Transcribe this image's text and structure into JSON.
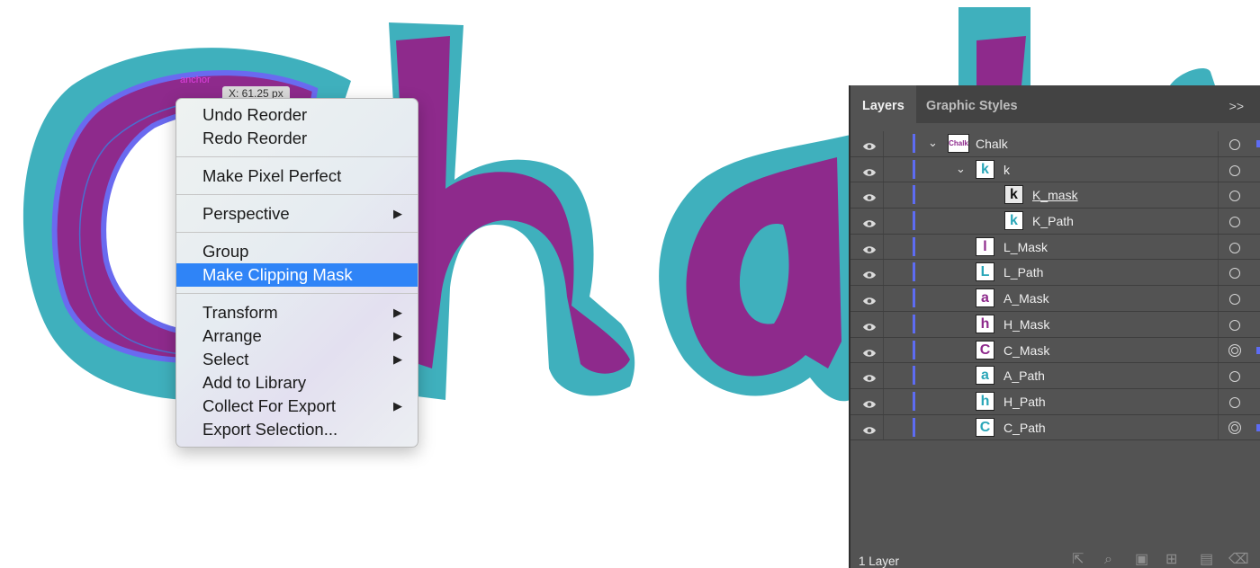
{
  "tooltip": {
    "text": "X: 61.25 px"
  },
  "canvas": {
    "anchor_label": "anchor"
  },
  "context_menu": {
    "items": [
      {
        "label": "Undo Reorder"
      },
      {
        "label": "Redo Reorder"
      },
      {
        "label": "Make Pixel Perfect"
      },
      {
        "label": "Perspective",
        "submenu": true
      },
      {
        "label": "Group"
      },
      {
        "label": "Make Clipping Mask",
        "selected": true
      },
      {
        "label": "Transform",
        "submenu": true
      },
      {
        "label": "Arrange",
        "submenu": true
      },
      {
        "label": "Select",
        "submenu": true
      },
      {
        "label": "Add to Library"
      },
      {
        "label": "Collect For Export",
        "submenu": true
      },
      {
        "label": "Export Selection..."
      }
    ]
  },
  "layers_panel": {
    "tabs": [
      {
        "label": "Layers",
        "active": true
      },
      {
        "label": "Graphic Styles",
        "active": false
      }
    ],
    "menu_icon": ">>",
    "layers": [
      {
        "name": "Chalk",
        "thumb": "Chalk",
        "indent": 0,
        "expanded": true
      },
      {
        "name": "k",
        "thumb": "k",
        "indent": 1,
        "expanded": true
      },
      {
        "name": "K_mask",
        "thumb": "k",
        "indent": 2
      },
      {
        "name": "K_Path",
        "thumb": "k",
        "indent": 2
      },
      {
        "name": "L_Mask",
        "thumb": "l",
        "indent": 1
      },
      {
        "name": "L_Path",
        "thumb": "L",
        "indent": 1
      },
      {
        "name": "A_Mask",
        "thumb": "a",
        "indent": 1
      },
      {
        "name": "H_Mask",
        "thumb": "h",
        "indent": 1
      },
      {
        "name": "C_Mask",
        "thumb": "C",
        "indent": 1
      },
      {
        "name": "A_Path",
        "thumb": "a",
        "indent": 1
      },
      {
        "name": "H_Path",
        "thumb": "h",
        "indent": 1
      },
      {
        "name": "C_Path",
        "thumb": "C",
        "indent": 1
      }
    ],
    "layer_count": "1 Layer"
  },
  "colors": {
    "teal": "#3fb0bd",
    "purple": "#8e2a8c",
    "selection_blue": "#5d6cf3",
    "menu_highlight": "#2f84f7"
  }
}
